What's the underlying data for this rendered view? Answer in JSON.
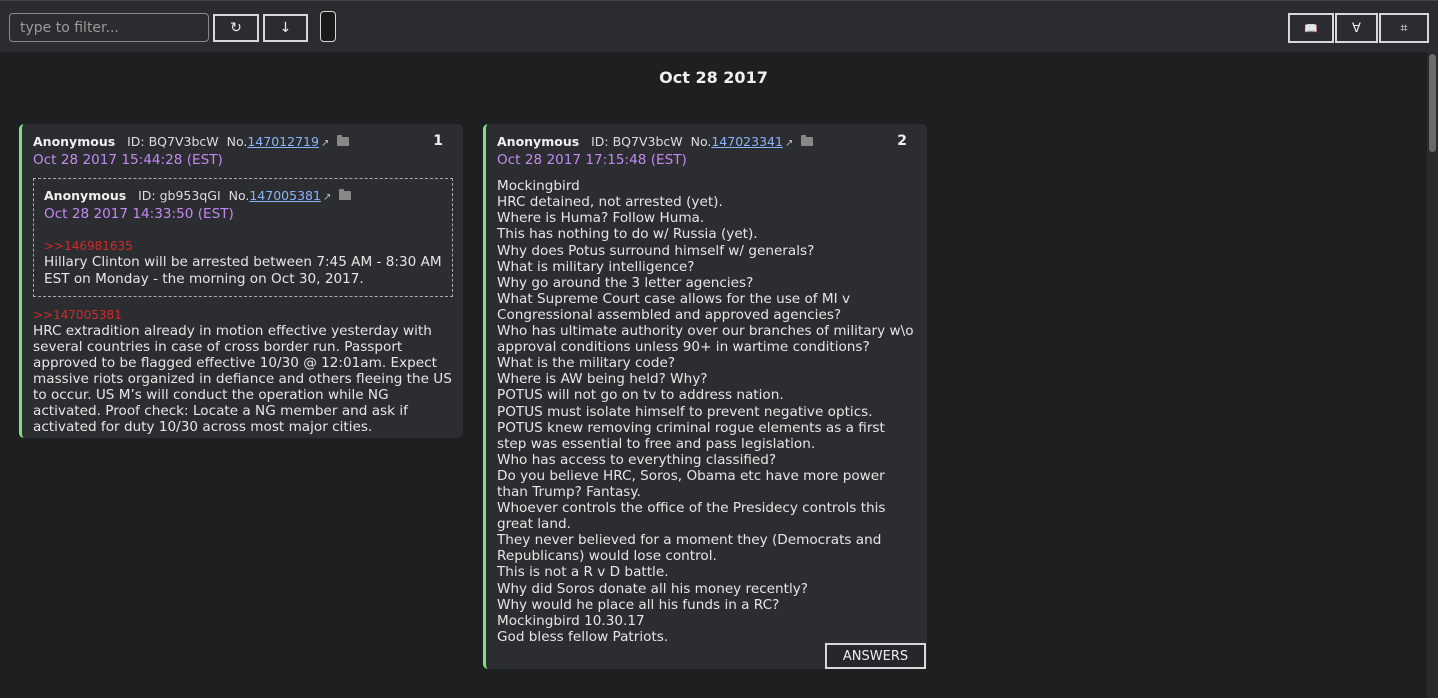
{
  "toolbar": {
    "filter_placeholder": "type to filter...",
    "refresh_label": "↻",
    "download_label": "↓",
    "book_label": "📖",
    "forall_label": "∀",
    "grid_label": "⌗"
  },
  "date_heading": "Oct 28 2017",
  "posts": [
    {
      "number": "1",
      "name": "Anonymous",
      "id_label": "ID: BQ7V3bcW",
      "no_prefix": "No.",
      "no_link": "147012719",
      "time": "Oct 28 2017 15:44:28 (EST)",
      "quoted": {
        "name": "Anonymous",
        "id_label": "ID: gb953qGI",
        "no_prefix": "No.",
        "no_link": "147005381",
        "time": "Oct 28 2017 14:33:50 (EST)",
        "ref": ">>146981635",
        "text": "Hillary Clinton will be arrested between 7:45 AM - 8:30 AM EST on Monday - the morning on Oct 30, 2017."
      },
      "ref": ">>147005381",
      "text": "HRC extradition already in motion effective yesterday with several countries in case of cross border run. Passport approved to be flagged effective 10/30 @ 12:01am. Expect massive riots organized in defiance and others fleeing the US to occur. US M’s will conduct the operation while NG activated. Proof check: Locate a NG member and ask if activated for duty 10/30 across most major cities."
    },
    {
      "number": "2",
      "name": "Anonymous",
      "id_label": "ID: BQ7V3bcW",
      "no_prefix": "No.",
      "no_link": "147023341",
      "time": "Oct 28 2017 17:15:48 (EST)",
      "lines": [
        "Mockingbird",
        "HRC detained, not arrested (yet).",
        "Where is Huma? Follow Huma.",
        "This has nothing to do w/ Russia (yet).",
        "Why does Potus surround himself w/ generals?",
        "What is military intelligence?",
        "Why go around the 3 letter agencies?",
        "What Supreme Court case allows for the use of MI v Congressional assembled and approved agencies?",
        "Who has ultimate authority over our branches of military w\\o approval conditions unless 90+ in wartime conditions?",
        "What is the military code?",
        "Where is AW being held? Why?",
        "POTUS will not go on tv to address nation.",
        "POTUS must isolate himself to prevent negative optics.",
        "POTUS knew removing criminal rogue elements as a first step was essential to free and pass legislation.",
        "Who has access to everything classified?",
        "Do you believe HRC, Soros, Obama etc have more power than Trump? Fantasy.",
        "Whoever controls the office of the Presidecy controls this great land.",
        "They never believed for a moment they (Democrats and Republicans) would lose control.",
        "This is not a R v D battle.",
        "Why did Soros donate all his money recently?",
        "Why would he place all his funds in a RC?",
        "Mockingbird 10.30.17",
        "God bless fellow Patriots."
      ],
      "answers_label": "ANSWERS"
    }
  ]
}
